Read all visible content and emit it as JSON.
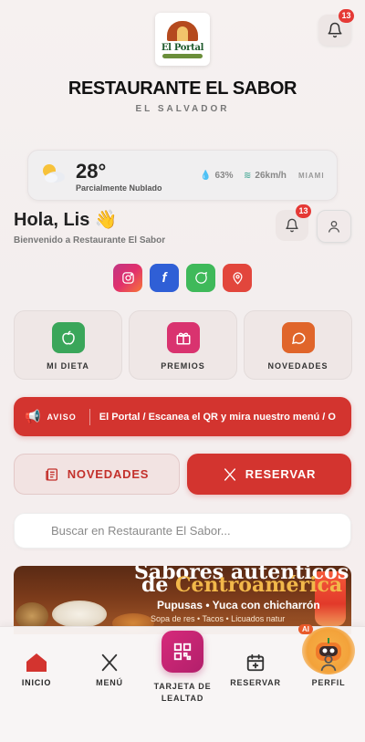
{
  "header": {
    "logo_text": "El Portal",
    "title": "RESTAURANTE EL SABOR",
    "subtitle": "EL SALVADOR",
    "notifications_count": "13"
  },
  "weather": {
    "temp": "28°",
    "description": "Parcialmente Nublado",
    "humidity": "63%",
    "wind": "26km/h",
    "city": "MIAMI"
  },
  "greeting": {
    "hello": "Hola, Lis 👋",
    "welcome": "Bienvenido a Restaurante El Sabor",
    "notifications_count": "13"
  },
  "social": [
    {
      "name": "instagram",
      "color": "#d6398a"
    },
    {
      "name": "facebook",
      "color": "#2f5fd6"
    },
    {
      "name": "whatsapp",
      "color": "#3fb95a"
    },
    {
      "name": "location",
      "color": "#e2463c"
    }
  ],
  "features": [
    {
      "label": "MI DIETA",
      "icon": "apple-icon",
      "color": "#3aa65a"
    },
    {
      "label": "PREMIOS",
      "icon": "gift-icon",
      "color": "#d9336f"
    },
    {
      "label": "NOVEDADES",
      "icon": "chat-icon",
      "color": "#e0652a"
    }
  ],
  "ticker": {
    "tag": "AVISO",
    "message": "El Portal / Escanea el QR y mira nuestro menú / O"
  },
  "actions": {
    "news": "NOVEDADES",
    "reserve": "RESERVAR"
  },
  "search": {
    "placeholder": "Buscar en Restaurante El Sabor..."
  },
  "banner": {
    "line1": "Sabores auténticos",
    "line2_prefix": "de ",
    "line2_highlight": "Centroamérica",
    "line3": "Pupusas • Yuca con chicharrón",
    "line4": "Sopa de res • Tacos • Licuados natur"
  },
  "bottom_nav": {
    "home": "INICIO",
    "menu": "MENÚ",
    "loyalty": "TARJETA DE LEALTAD",
    "reserve": "RESERVAR",
    "profile": "PERFIL",
    "ai_badge": "AI"
  },
  "colors": {
    "accent": "#d3342f",
    "brand_green": "#1f5a2e"
  }
}
